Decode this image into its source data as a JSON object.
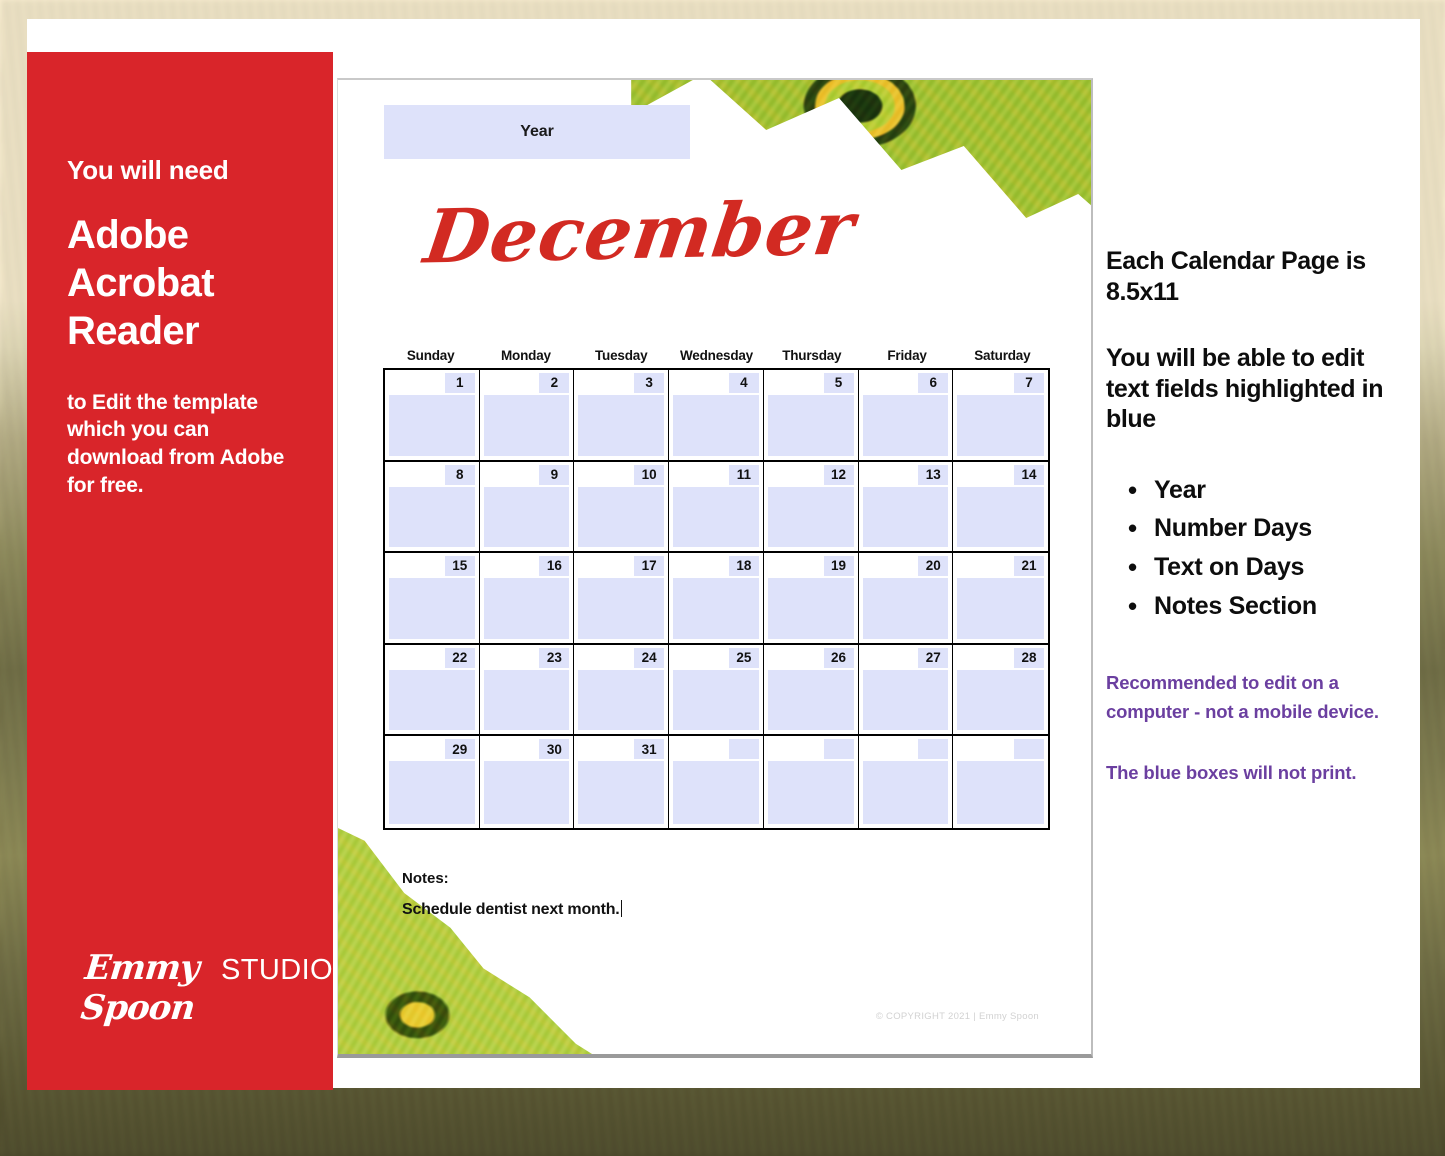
{
  "theme": {
    "red": "#d9252a",
    "month_red": "#d22a22",
    "field_blue": "#dee2fa",
    "purple": "#6b3fa0",
    "card_white": "#ffffff",
    "page_bg": "#f8ecd0"
  },
  "left_panel": {
    "lead": "You will need",
    "headline": "Adobe Acrobat Reader",
    "sub": "to Edit the template which you can download from Adobe for  free.",
    "logo_script": "Emmy Spoon",
    "logo_studio": "STUDIO"
  },
  "calendar": {
    "year_field_label": "Year",
    "month": "December",
    "weekdays": [
      "Sunday",
      "Monday",
      "Tuesday",
      "Wednesday",
      "Thursday",
      "Friday",
      "Saturday"
    ],
    "weeks": [
      [
        "1",
        "2",
        "3",
        "4",
        "5",
        "6",
        "7"
      ],
      [
        "8",
        "9",
        "10",
        "11",
        "12",
        "13",
        "14"
      ],
      [
        "15",
        "16",
        "17",
        "18",
        "19",
        "20",
        "21"
      ],
      [
        "22",
        "23",
        "24",
        "25",
        "26",
        "27",
        "28"
      ],
      [
        "29",
        "30",
        "31",
        "",
        "",
        "",
        ""
      ]
    ],
    "notes_label": "Notes:",
    "notes_value": "Schedule dentist next month.",
    "copyright": "© COPYRIGHT 2021  |  Emmy Spoon"
  },
  "info_column": {
    "heading1": "Each Calendar Page is 8.5x11",
    "heading2": "You will be able to edit text fields highlighted in blue",
    "bullets": [
      "Year",
      "Number Days",
      "Text on Days",
      "Notes Section"
    ],
    "note1": "Recommended to edit on a computer - not a mobile device.",
    "note2": "The blue boxes will not print."
  }
}
